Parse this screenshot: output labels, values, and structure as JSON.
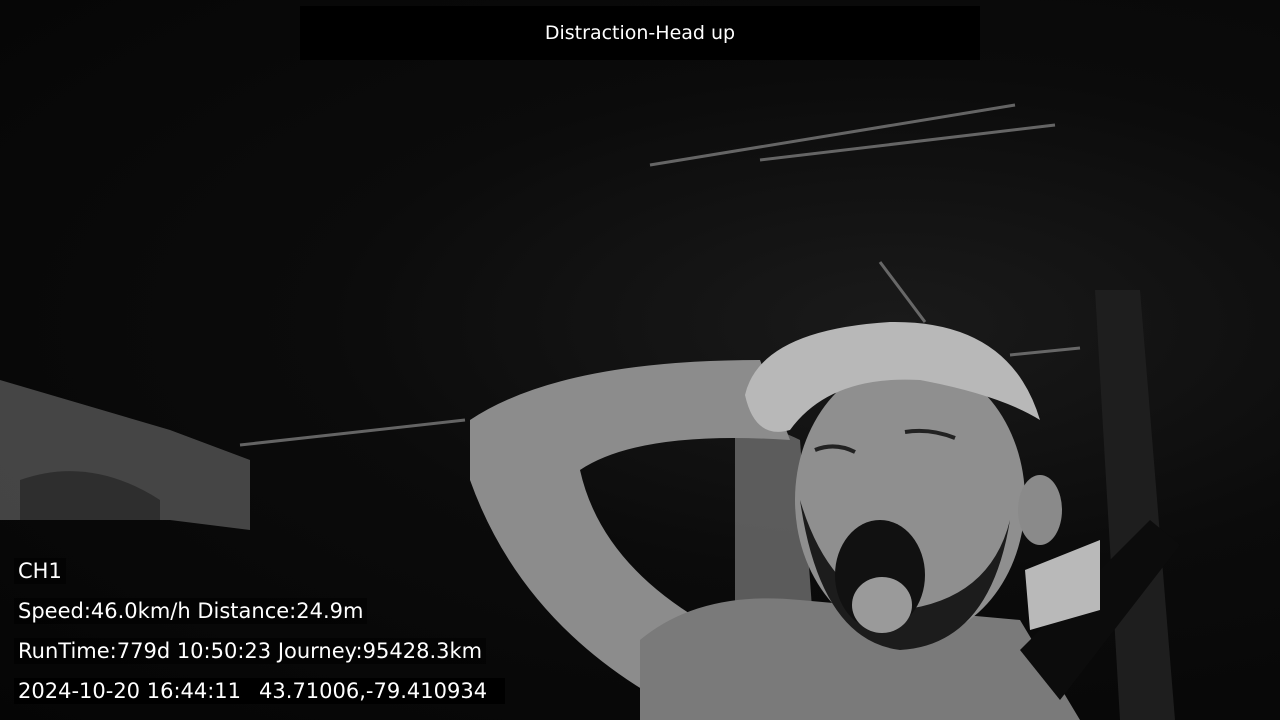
{
  "alert": {
    "title": "Distraction-Head up"
  },
  "osd": {
    "channel": "CH1",
    "speed_distance": "Speed:46.0km/h Distance:24.9m",
    "runtime_journey": "RunTime:779d 10:50:23 Journey:95428.3km",
    "datetime": "2024-10-20 16:44:11",
    "gps": "43.71006,-79.410934"
  }
}
